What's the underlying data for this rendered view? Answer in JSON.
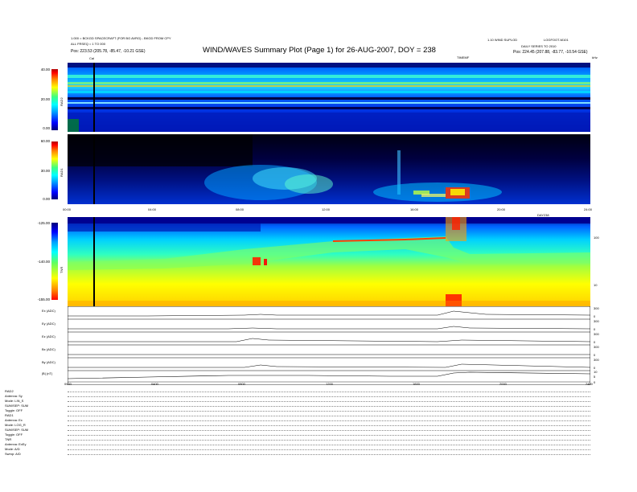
{
  "header": {
    "left_line1": "1.000 = BCKGD SPACECRAFT (FOR BG AVRG) - BKGD FROM CPY",
    "left_line2": "ALL FRSEQ = 1 TO 000",
    "left_line3": "Pos:   223.53 (205.78, -85.47, -10.21 GSE)",
    "title": "WIND/WAVES Summary Plot (Page 1) for 26-AUG-2007, DOY = 238",
    "right_line1": "1.10 WIND SUPLOD",
    "right_line2": "DAILY SERIES TO 2010",
    "right_line3": "Pos:   224.45 (207.88, -83.77, -10.54 GSE)",
    "right_tag": "LOGFOOT-M101",
    "tnr_tag": "TIMEMF",
    "hz_tag": "kHz",
    "cal_label": "Cal"
  },
  "rad2": {
    "label": "RAD2",
    "ticks": [
      "40.00",
      "20.00",
      "0.00"
    ]
  },
  "rad1": {
    "label": "RAD1",
    "ticks": [
      "60.00",
      "30.00",
      "0.00"
    ]
  },
  "time_axis_top": {
    "ticks": [
      "00:00",
      "04:00",
      "08:00",
      "12:00",
      "16:00",
      "20:00",
      "24:00"
    ],
    "unit": "DAY238"
  },
  "tnr": {
    "label": "TNR",
    "ticks": [
      "-125.00",
      "-140.00",
      "-155.00"
    ],
    "right_ticks": [
      "100",
      "10"
    ]
  },
  "traces": {
    "rows": [
      {
        "label": "Ex (ADC)",
        "right_ticks": [
          "300",
          "0"
        ]
      },
      {
        "label": "Ey (ADC)",
        "right_ticks": [
          "300",
          "0"
        ]
      },
      {
        "label": "Ez (ADC)",
        "right_ticks": [
          "300",
          "0"
        ]
      },
      {
        "label": "Bx (ADC)",
        "right_ticks": [
          "300",
          "0"
        ]
      },
      {
        "label": "By (ADC)",
        "right_ticks": [
          "300",
          "0"
        ]
      },
      {
        "label": "|B| (nT)",
        "right_ticks": [
          "10",
          "5",
          "0"
        ]
      }
    ],
    "time_ticks": [
      "0000",
      "0400",
      "0800",
      "1200",
      "1600",
      "2000",
      "2400"
    ]
  },
  "footer": {
    "rows": [
      {
        "label": "RAD2"
      },
      {
        "label": "Antenna:   Sy"
      },
      {
        "label": "Mode:   LIN_S"
      },
      {
        "label": "SUM/SEP:  SUM"
      },
      {
        "label": "Toggle:    OFF"
      },
      {
        "label": "RAD1"
      },
      {
        "label": "Antenna:    Ex"
      },
      {
        "label": "Mode:   LOG_R"
      },
      {
        "label": "SUM/SEP: SUM"
      },
      {
        "label": "Toggle:    OFF"
      },
      {
        "label": "TNR"
      },
      {
        "label": "Antenna:   ExEy"
      },
      {
        "label": "Mode:    A/D"
      },
      {
        "label": "Swmp:    A/D"
      }
    ]
  },
  "chart_data": [
    {
      "type": "heatmap",
      "title": "WIND/WAVES Summary Plot (Page 1) for 26-AUG-2007, DOY = 238",
      "panel": "RAD2",
      "x_range_hours": [
        0,
        24
      ],
      "y_ticks": [
        40.0,
        20.0,
        0.0
      ],
      "colorscale": [
        "#00007a",
        "#0000ff",
        "#00ffff",
        "#ffff00",
        "#ff0000"
      ]
    },
    {
      "type": "heatmap",
      "panel": "RAD1",
      "x_range_hours": [
        0,
        24
      ],
      "y_ticks": [
        60.0,
        30.0,
        0.0
      ],
      "features": [
        {
          "start_h": 8.5,
          "end_h": 10.5,
          "level": "moderate"
        },
        {
          "start_h": 17.8,
          "end_h": 19.0,
          "level": "high"
        }
      ]
    },
    {
      "type": "heatmap",
      "panel": "TNR",
      "x_range_hours": [
        0,
        24
      ],
      "y_ticks": [
        -125.0,
        -140.0,
        -155.0
      ],
      "right_ticks": [
        100,
        10
      ],
      "features": [
        {
          "start_h": 7.8,
          "end_h": 8.8,
          "level": "high"
        },
        {
          "start_h": 15.5,
          "end_h": 18.5,
          "level": "high"
        }
      ]
    },
    {
      "type": "line",
      "panel": "traces",
      "x_ticks": [
        "0000",
        "0400",
        "0800",
        "1200",
        "1600",
        "2000",
        "2400"
      ],
      "series": [
        {
          "name": "Ex (ADC)"
        },
        {
          "name": "Ey (ADC)"
        },
        {
          "name": "Ez (ADC)"
        },
        {
          "name": "Bx (ADC)"
        },
        {
          "name": "By (ADC)"
        },
        {
          "name": "|B| (nT)"
        }
      ]
    }
  ]
}
